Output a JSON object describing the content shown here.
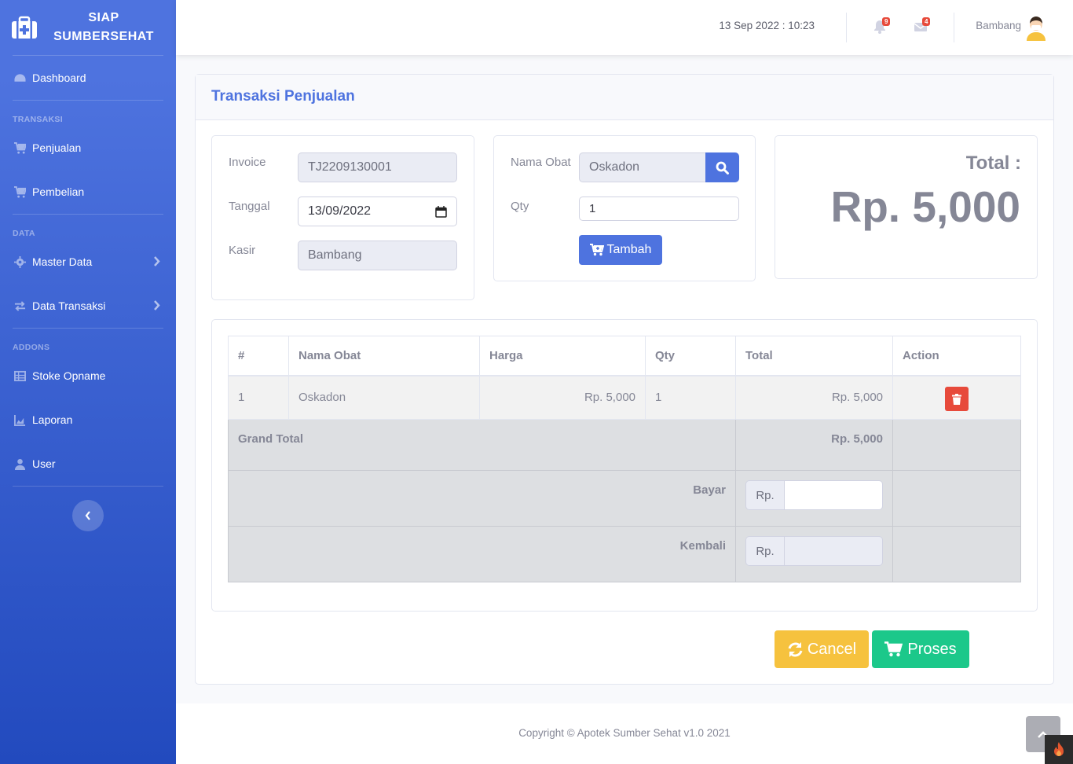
{
  "brand": {
    "line1": "SIAP",
    "line2": "SUMBERSEHAT"
  },
  "sidebar": {
    "dashboard": "Dashboard",
    "heading_transaksi": "TRANSAKSI",
    "penjualan": "Penjualan",
    "pembelian": "Pembelian",
    "heading_data": "DATA",
    "master_data": "Master Data",
    "data_transaksi": "Data Transaksi",
    "heading_addons": "ADDONS",
    "stoke_opname": "Stoke Opname",
    "laporan": "Laporan",
    "user": "User"
  },
  "topbar": {
    "datetime": "13 Sep 2022 : 10:23",
    "alerts_count": "9",
    "messages_count": "4",
    "user_name": "Bambang"
  },
  "card": {
    "title": "Transaksi Penjualan"
  },
  "form": {
    "invoice_label": "Invoice",
    "invoice_value": "TJ2209130001",
    "tanggal_label": "Tanggal",
    "tanggal_value": "13/09/2022",
    "kasir_label": "Kasir",
    "kasir_value": "Bambang"
  },
  "add_item": {
    "nama_obat_label": "Nama Obat",
    "nama_obat_value": "Oskadon",
    "qty_label": "Qty",
    "qty_value": "1",
    "tambah_label": "Tambah"
  },
  "total": {
    "label": "Total :",
    "value": "Rp. 5,000"
  },
  "table": {
    "headers": [
      "#",
      "Nama Obat",
      "Harga",
      "Qty",
      "Total",
      "Action"
    ],
    "rows": [
      {
        "no": "1",
        "nama": "Oskadon",
        "harga": "Rp. 5,000",
        "qty": "1",
        "total": "Rp. 5,000"
      }
    ],
    "grand_total_label": "Grand Total",
    "grand_total_value": "Rp. 5,000",
    "bayar_label": "Bayar",
    "kembali_label": "Kembali",
    "currency_prefix": "Rp."
  },
  "actions": {
    "cancel": "Cancel",
    "proses": "Proses"
  },
  "footer": {
    "copyright": "Copyright © Apotek Sumber Sehat v1.0 2021"
  },
  "colors": {
    "primary": "#4e73df",
    "warning": "#f6c23e",
    "success": "#1cc88a",
    "danger": "#e74a3b"
  }
}
